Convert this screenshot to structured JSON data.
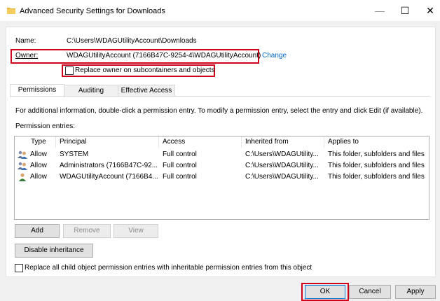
{
  "window": {
    "title": "Advanced Security Settings for Downloads",
    "minimize": "—",
    "maximize": "☐",
    "close": "✕"
  },
  "name": {
    "label": "Name:",
    "value": "C:\\Users\\WDAGUtilityAccount\\Downloads"
  },
  "owner": {
    "label": "Owner:",
    "value": "WDAGUtilityAccount (7166B47C-9254-4\\WDAGUtilityAccount)",
    "change_link": "Change"
  },
  "replace_owner": {
    "label": "Replace owner on subcontainers and objects",
    "checked": false
  },
  "tabs": [
    {
      "label": "Permissions",
      "active": true
    },
    {
      "label": "Auditing",
      "active": false
    },
    {
      "label": "Effective Access",
      "active": false
    }
  ],
  "info_text": "For additional information, double-click a permission entry. To modify a permission entry, select the entry and click Edit (if available).",
  "entries_label": "Permission entries:",
  "columns": [
    "Type",
    "Principal",
    "Access",
    "Inherited from",
    "Applies to"
  ],
  "entries": [
    {
      "type": "Allow",
      "principal": "SYSTEM",
      "access": "Full control",
      "inherited": "C:\\Users\\WDAGUtility...",
      "applies": "This folder, subfolders and files",
      "icon": "group-user-icon"
    },
    {
      "type": "Allow",
      "principal": "Administrators (7166B47C-92...",
      "access": "Full control",
      "inherited": "C:\\Users\\WDAGUtility...",
      "applies": "This folder, subfolders and files",
      "icon": "group-user-icon"
    },
    {
      "type": "Allow",
      "principal": "WDAGUtilityAccount (7166B4...",
      "access": "Full control",
      "inherited": "C:\\Users\\WDAGUtility...",
      "applies": "This folder, subfolders and files",
      "icon": "single-user-icon"
    }
  ],
  "buttons": {
    "add": "Add",
    "remove": "Remove",
    "view": "View",
    "disable_inheritance": "Disable inheritance",
    "ok": "OK",
    "cancel": "Cancel",
    "apply": "Apply"
  },
  "replace_child": {
    "label": "Replace all child object permission entries with inheritable permission entries from this object",
    "checked": false
  },
  "colors": {
    "highlight": "#d0021b",
    "link": "#0066cc"
  }
}
